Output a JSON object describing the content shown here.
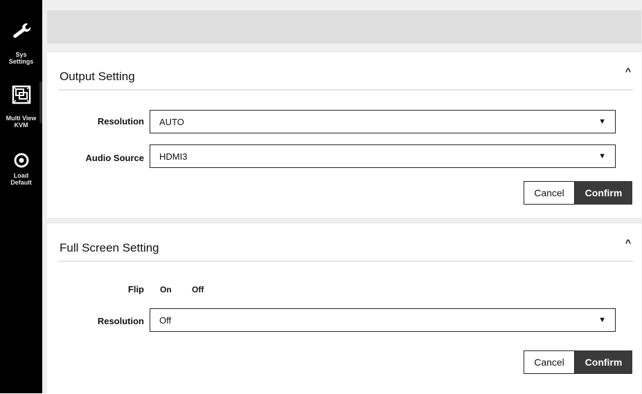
{
  "sidebar": {
    "items": [
      {
        "label": "Sys\nSettings",
        "icon": "wrench-icon"
      },
      {
        "label": "Multi View\nKVM",
        "icon": "multiview-icon"
      },
      {
        "label": "Load\nDefault",
        "icon": "reset-circle-icon"
      }
    ]
  },
  "output_setting": {
    "title": "Output Setting",
    "collapse_glyph": "^",
    "resolution_label": "Resolution",
    "resolution_value": "AUTO",
    "audio_label": "Audio Source",
    "audio_value": "HDMI3",
    "arrow_glyph": "▼",
    "cancel_label": "Cancel",
    "confirm_label": "Confirm"
  },
  "full_screen_setting": {
    "title": "Full Screen Setting",
    "collapse_glyph": "^",
    "flip_label": "Flip",
    "flip_on": "On",
    "flip_off": "Off",
    "resolution_label": "Resolution",
    "resolution_value": "Off",
    "arrow_glyph": "▼",
    "cancel_label": "Cancel",
    "confirm_label": "Confirm"
  }
}
